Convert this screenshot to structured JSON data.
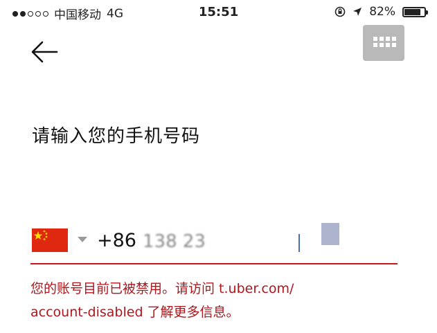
{
  "status_bar": {
    "carrier": "中国移动",
    "network": "4G",
    "time": "15:51",
    "battery": "82%",
    "signal_bars_filled": 2,
    "signal_bars_total": 5,
    "battery_level": 0.82
  },
  "header": {
    "back_icon": "arrow-left-icon",
    "keyboard_icon": "keypad-icon"
  },
  "form": {
    "prompt": "请输入您的手机号码",
    "country_flag": "china-flag",
    "country_code": "+86",
    "phone_value": "138 23",
    "phone_placeholder": ""
  },
  "error": {
    "message_line1": "您的账号目前已被禁用。请访问 t.uber.com/",
    "message_line2": "account-disabled 了解更多信息。"
  },
  "colors": {
    "error": "#b3141a",
    "underline": "#c8171b",
    "flag_red": "#de2910",
    "flag_yellow": "#ffde00",
    "keypad_button": "#b9b9b9"
  }
}
